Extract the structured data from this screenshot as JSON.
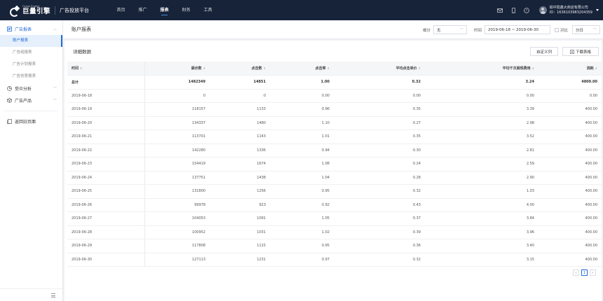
{
  "topbar": {
    "logo_en": "Ocean Engine",
    "logo_cn": "巨量引擎",
    "platform": "广告投放平台",
    "nav": [
      "首页",
      "推广",
      "报表",
      "财务",
      "工具"
    ],
    "active_nav": "报表",
    "company": "榆中隐鑫大商店有限公司",
    "user_id": "ID：1636103983204359"
  },
  "sidebar": {
    "groups": [
      {
        "label": "广告报表",
        "icon": "report-icon",
        "open": true,
        "items": [
          "账户报表",
          "广告组报表",
          "广告计划报表",
          "广告创意报表"
        ]
      },
      {
        "label": "受众分析",
        "icon": "audience-icon",
        "open": false,
        "items": []
      },
      {
        "label": "广告产品",
        "icon": "product-icon",
        "open": false,
        "items": []
      }
    ],
    "active_item": "账户报表",
    "back_label": "返回旧页面"
  },
  "header": {
    "title": "账户报表",
    "breakdown_label": "细分",
    "breakdown_value": "无",
    "time_label": "时间",
    "date_range": "2019-06-18 ~ 2019-06-30",
    "compare_label": "对比",
    "granularity": "分日"
  },
  "card": {
    "title": "详细数据",
    "custom_columns": "自定义列",
    "download": "下载表格"
  },
  "table": {
    "columns": [
      "时间",
      "展示数",
      "点击数",
      "点击率",
      "平均点击单价",
      "平均千次展现费用",
      "消耗"
    ],
    "total": [
      "总计",
      "1482349",
      "14851",
      "1.00",
      "0.32",
      "3.24",
      "4800.00"
    ],
    "rows": [
      [
        "2019-06-18",
        "0",
        "0",
        "0.00",
        "0.00",
        "0.00",
        "0.00"
      ],
      [
        "2019-06-19",
        "118157",
        "1133",
        "0.96",
        "0.35",
        "3.39",
        "400.00"
      ],
      [
        "2019-06-20",
        "134337",
        "1480",
        "1.10",
        "0.27",
        "2.98",
        "400.00"
      ],
      [
        "2019-06-21",
        "113701",
        "1143",
        "1.01",
        "0.35",
        "3.52",
        "400.00"
      ],
      [
        "2019-06-22",
        "142280",
        "1336",
        "0.94",
        "0.30",
        "2.81",
        "400.00"
      ],
      [
        "2019-06-23",
        "154419",
        "1674",
        "1.08",
        "0.24",
        "2.59",
        "400.00"
      ],
      [
        "2019-06-24",
        "137751",
        "1438",
        "1.04",
        "0.28",
        "2.90",
        "400.00"
      ],
      [
        "2019-06-25",
        "131800",
        "1256",
        "0.95",
        "0.32",
        "1.03",
        "400.00"
      ],
      [
        "2019-06-26",
        "99978",
        "923",
        "0.92",
        "0.43",
        "4.00",
        "400.00"
      ],
      [
        "2019-06-27",
        "104053",
        "1091",
        "1.05",
        "0.37",
        "3.84",
        "400.00"
      ],
      [
        "2019-06-28",
        "100952",
        "1031",
        "1.02",
        "0.39",
        "3.96",
        "400.00"
      ],
      [
        "2019-06-29",
        "117808",
        "1115",
        "0.95",
        "0.36",
        "3.40",
        "400.00"
      ],
      [
        "2019-06-30",
        "127113",
        "1231",
        "0.97",
        "0.32",
        "3.15",
        "400.00"
      ]
    ]
  },
  "pager": {
    "prev": "‹",
    "current": "1",
    "next": "›"
  }
}
